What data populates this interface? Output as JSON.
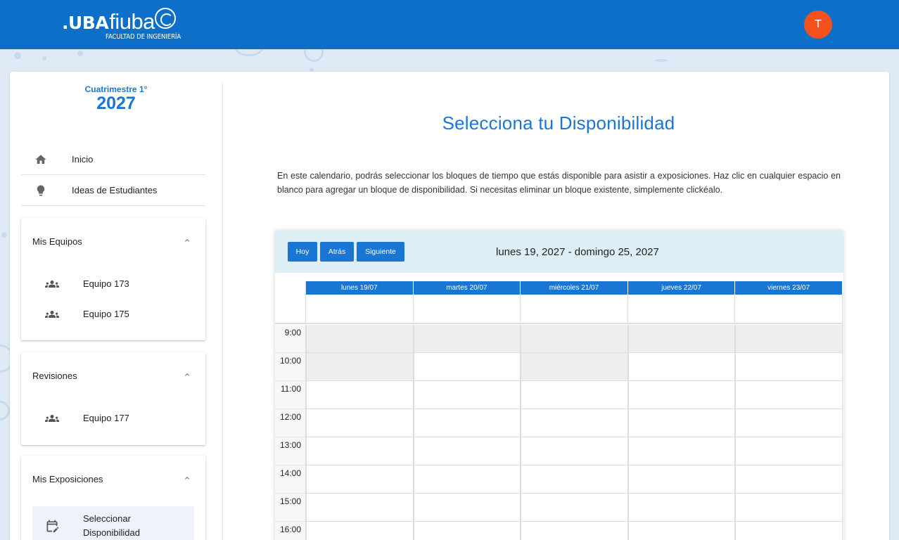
{
  "header": {
    "logo_uba": ".UBA",
    "logo_fiuba": "fiuba",
    "logo_sub": "FACULTAD DE INGENIERÍA",
    "avatar_initial": "T",
    "avatar_color": "#f4511e",
    "brand_color": "#0d6fc7"
  },
  "sidebar": {
    "term_label": "Cuatrimestre 1°",
    "term_year": "2027",
    "nav": [
      {
        "label": "Inicio",
        "icon": "home-icon"
      },
      {
        "label": "Ideas de Estudiantes",
        "icon": "lightbulb-icon"
      }
    ],
    "panels": {
      "mis_equipos": {
        "title": "Mis Equipos",
        "items": [
          "Equipo 173",
          "Equipo 175"
        ]
      },
      "revisiones": {
        "title": "Revisiones",
        "items": [
          "Equipo 177"
        ]
      },
      "mis_exposiciones": {
        "title": "Mis Exposiciones",
        "items": [
          "Seleccionar Disponibilidad"
        ]
      }
    }
  },
  "main": {
    "title": "Selecciona tu Disponibilidad",
    "description": "En este calendario, podrás seleccionar los bloques de tiempo que estás disponible para asistir a exposiciones. Haz clic en cualquier espacio en blanco para agregar un bloque de disponibilidad. Si necesitas eliminar un bloque existente, simplemente clickéalo.",
    "calendar": {
      "btn_today": "Hoy",
      "btn_back": "Atrás",
      "btn_next": "Siguiente",
      "range": "lunes 19, 2027 - domingo 25, 2027",
      "days": [
        "lunes 19/07",
        "martes 20/07",
        "miércoles 21/07",
        "jueves 22/07",
        "viernes 23/07"
      ],
      "times": [
        "9:00",
        "10:00",
        "11:00",
        "12:00",
        "13:00",
        "14:00",
        "15:00",
        "16:00"
      ],
      "busy": [
        [
          0,
          0
        ],
        [
          0,
          1
        ],
        [
          0,
          2
        ],
        [
          0,
          3
        ],
        [
          0,
          4
        ],
        [
          1,
          0
        ],
        [
          1,
          2
        ]
      ]
    }
  }
}
